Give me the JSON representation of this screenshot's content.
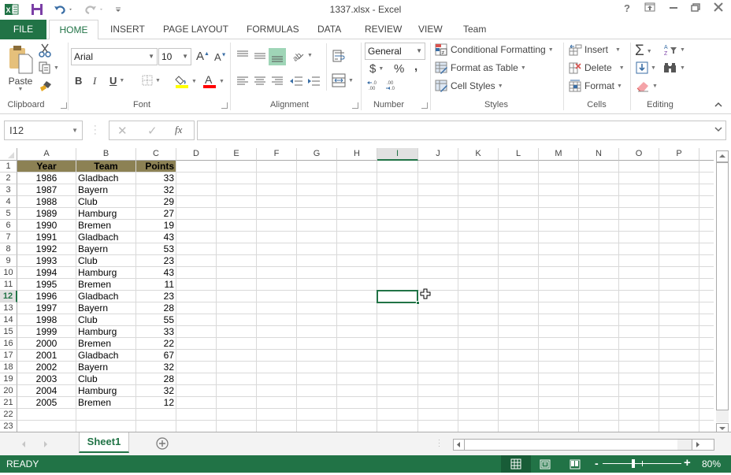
{
  "window": {
    "title": "1337.xlsx - Excel",
    "controls": {
      "help": "?",
      "ribbon_display": "ribbon-display-icon",
      "minimize": "minimize-icon",
      "restore": "restore-icon",
      "close": "close-icon"
    }
  },
  "quick_access": {
    "app_icon": "excel-icon",
    "save": "save-icon",
    "undo": "undo-icon",
    "redo": "redo-icon",
    "customize": "customize-icon"
  },
  "tabs": [
    {
      "label": "FILE"
    },
    {
      "label": "HOME",
      "active": true
    },
    {
      "label": "INSERT"
    },
    {
      "label": "PAGE LAYOUT"
    },
    {
      "label": "FORMULAS"
    },
    {
      "label": "DATA"
    },
    {
      "label": "REVIEW"
    },
    {
      "label": "VIEW"
    },
    {
      "label": "Team"
    }
  ],
  "ribbon": {
    "clipboard": {
      "label": "Clipboard",
      "paste": "Paste"
    },
    "font": {
      "label": "Font",
      "name": "Arial",
      "size": "10",
      "bold": "B",
      "italic": "I",
      "underline": "U",
      "fill_color": "#ffff00",
      "font_color": "#ff0000"
    },
    "alignment": {
      "label": "Alignment"
    },
    "number": {
      "label": "Number",
      "format": "General",
      "currency": "$",
      "percent": "%",
      "comma": ",",
      "inc_decimal": "←.0 .00",
      "dec_decimal": ".00 →.0"
    },
    "styles": {
      "label": "Styles",
      "conditional": "Conditional Formatting",
      "format_table": "Format as Table",
      "cell_styles": "Cell Styles"
    },
    "cells": {
      "label": "Cells",
      "insert": "Insert",
      "delete": "Delete",
      "format": "Format"
    },
    "editing": {
      "label": "Editing"
    }
  },
  "formula_bar": {
    "name_box": "I12",
    "fx": "fx",
    "cancel": "✕",
    "enter": "✓",
    "value": ""
  },
  "columns": [
    "A",
    "B",
    "C",
    "D",
    "E",
    "F",
    "G",
    "H",
    "I",
    "J",
    "K",
    "L",
    "M",
    "N",
    "O",
    "P"
  ],
  "selected_column": "I",
  "selected_row": 12,
  "selected_cell": "I12",
  "rows": [
    "1",
    "2",
    "3",
    "4",
    "5",
    "6",
    "7",
    "8",
    "9",
    "10",
    "11",
    "12",
    "13",
    "14",
    "15",
    "16",
    "17",
    "18",
    "19",
    "20",
    "21",
    "22",
    "23"
  ],
  "table": {
    "header": [
      "Year",
      "Team",
      "Points"
    ],
    "header_fill": "#8c8154",
    "data": [
      [
        "1986",
        "Gladbach",
        "33"
      ],
      [
        "1987",
        "Bayern",
        "32"
      ],
      [
        "1988",
        "Club",
        "29"
      ],
      [
        "1989",
        "Hamburg",
        "27"
      ],
      [
        "1990",
        "Bremen",
        "19"
      ],
      [
        "1991",
        "Gladbach",
        "43"
      ],
      [
        "1992",
        "Bayern",
        "53"
      ],
      [
        "1993",
        "Club",
        "23"
      ],
      [
        "1994",
        "Hamburg",
        "43"
      ],
      [
        "1995",
        "Bremen",
        "11"
      ],
      [
        "1996",
        "Gladbach",
        "23"
      ],
      [
        "1997",
        "Bayern",
        "28"
      ],
      [
        "1998",
        "Club",
        "55"
      ],
      [
        "1999",
        "Hamburg",
        "33"
      ],
      [
        "2000",
        "Bremen",
        "22"
      ],
      [
        "2001",
        "Gladbach",
        "67"
      ],
      [
        "2002",
        "Bayern",
        "32"
      ],
      [
        "2003",
        "Club",
        "28"
      ],
      [
        "2004",
        "Hamburg",
        "32"
      ],
      [
        "2005",
        "Bremen",
        "12"
      ]
    ]
  },
  "sheets": [
    {
      "name": "Sheet1",
      "active": true
    }
  ],
  "status": {
    "mode": "READY",
    "zoom": "80%",
    "zoom_minus": "-",
    "zoom_plus": "+",
    "zoom_value": 80
  },
  "accent": "#217346"
}
